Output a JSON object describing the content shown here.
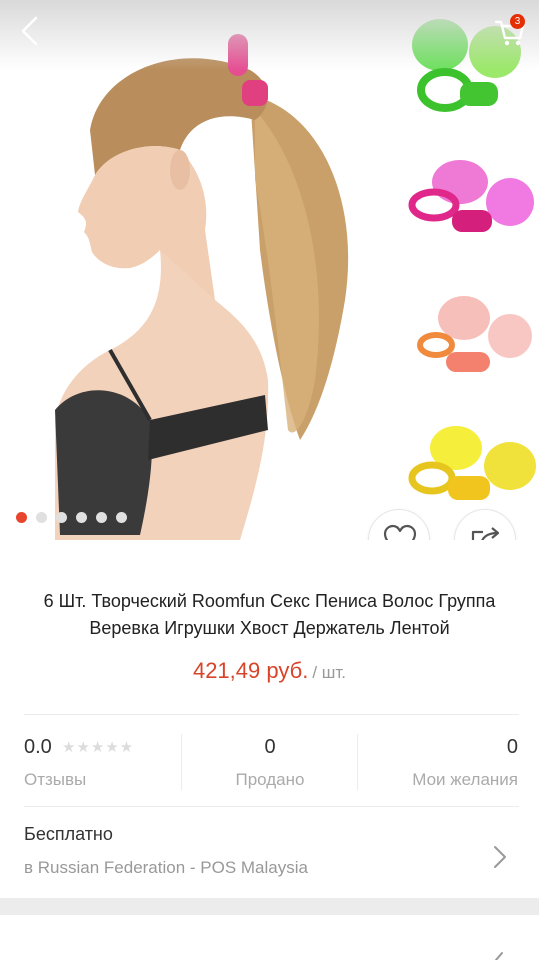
{
  "header": {
    "cart_count": "3"
  },
  "gallery": {
    "dot_count": 6,
    "active_index": 0
  },
  "product": {
    "title": "6 Шт. Творческий Roomfun Секс Пениса Волос Группа Веревка Игрушки Хвост Держатель Лентой",
    "price": "421,49 руб.",
    "unit": "/ шт."
  },
  "stats": {
    "rating": "0.0",
    "reviews_label": "Отзывы",
    "sold": "0",
    "sold_label": "Продано",
    "wishes": "0",
    "wishes_label": "Мои желания"
  },
  "shipping": {
    "title": "Бесплатно",
    "detail": "в Russian Federation - POS Malaysia"
  },
  "colors": {
    "accent": "#e8452f",
    "price": "#d8442a",
    "badge": "#e62e04"
  }
}
